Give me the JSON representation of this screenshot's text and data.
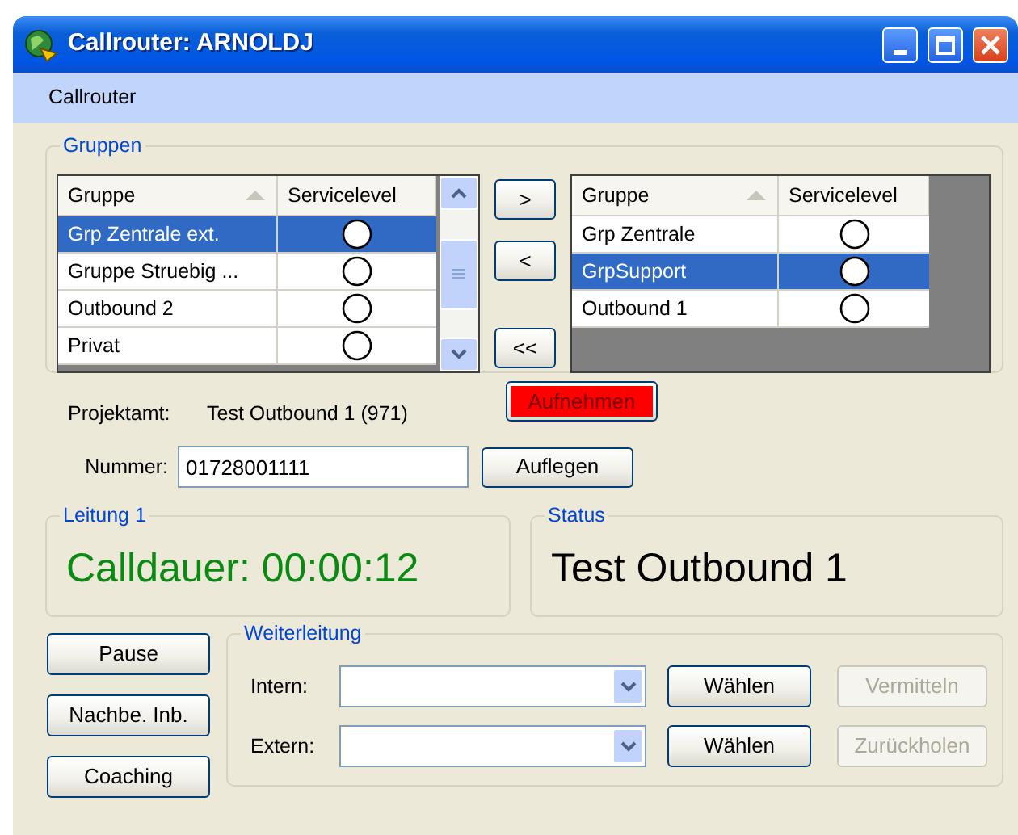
{
  "window": {
    "title": "Callrouter: ARNOLDJ"
  },
  "menu": [
    {
      "label": "Callrouter"
    }
  ],
  "groups": {
    "title": "Gruppen",
    "available": {
      "columns": [
        {
          "label": "Gruppe",
          "sorted": true
        },
        {
          "label": "Servicelevel",
          "sorted": false
        }
      ],
      "rows": [
        {
          "name": "Grp Zentrale ext.",
          "selected": true
        },
        {
          "name": "Gruppe Struebig ...",
          "selected": false
        },
        {
          "name": "Outbound 2",
          "selected": false
        },
        {
          "name": "Privat",
          "selected": false
        }
      ]
    },
    "move_buttons": [
      {
        "label": ">"
      },
      {
        "label": "<"
      },
      {
        "label": "<<"
      }
    ],
    "assigned": {
      "columns": [
        {
          "label": "Gruppe",
          "sorted": true
        },
        {
          "label": "Servicelevel",
          "sorted": false
        }
      ],
      "rows": [
        {
          "name": "Grp Zentrale",
          "selected": false
        },
        {
          "name": "GrpSupport",
          "selected": true
        },
        {
          "name": "Outbound 1",
          "selected": false
        }
      ]
    }
  },
  "call": {
    "project_label": "Projektamt:",
    "project_value": "Test Outbound 1 (971)",
    "number_label": "Nummer:",
    "number_value": "01728001111",
    "buttons": [
      {
        "label": "Aufnehmen",
        "kind": "alert"
      },
      {
        "label": "Auflegen",
        "kind": "normal"
      }
    ]
  },
  "line": {
    "title": "Leitung 1",
    "text": "Calldauer: 00:00:12"
  },
  "status": {
    "title": "Status",
    "text": "Test Outbound 1"
  },
  "side_buttons": [
    {
      "label": "Pause"
    },
    {
      "label": "Nachbe. Inb."
    },
    {
      "label": "Coaching"
    }
  ],
  "forwarding": {
    "title": "Weiterleitung",
    "rows": [
      {
        "label": "Intern:",
        "choose": "Wählen",
        "action": "Vermitteln",
        "action_disabled": true
      },
      {
        "label": "Extern:",
        "choose": "Wählen",
        "action": "Zurückholen",
        "action_disabled": true
      }
    ]
  }
}
